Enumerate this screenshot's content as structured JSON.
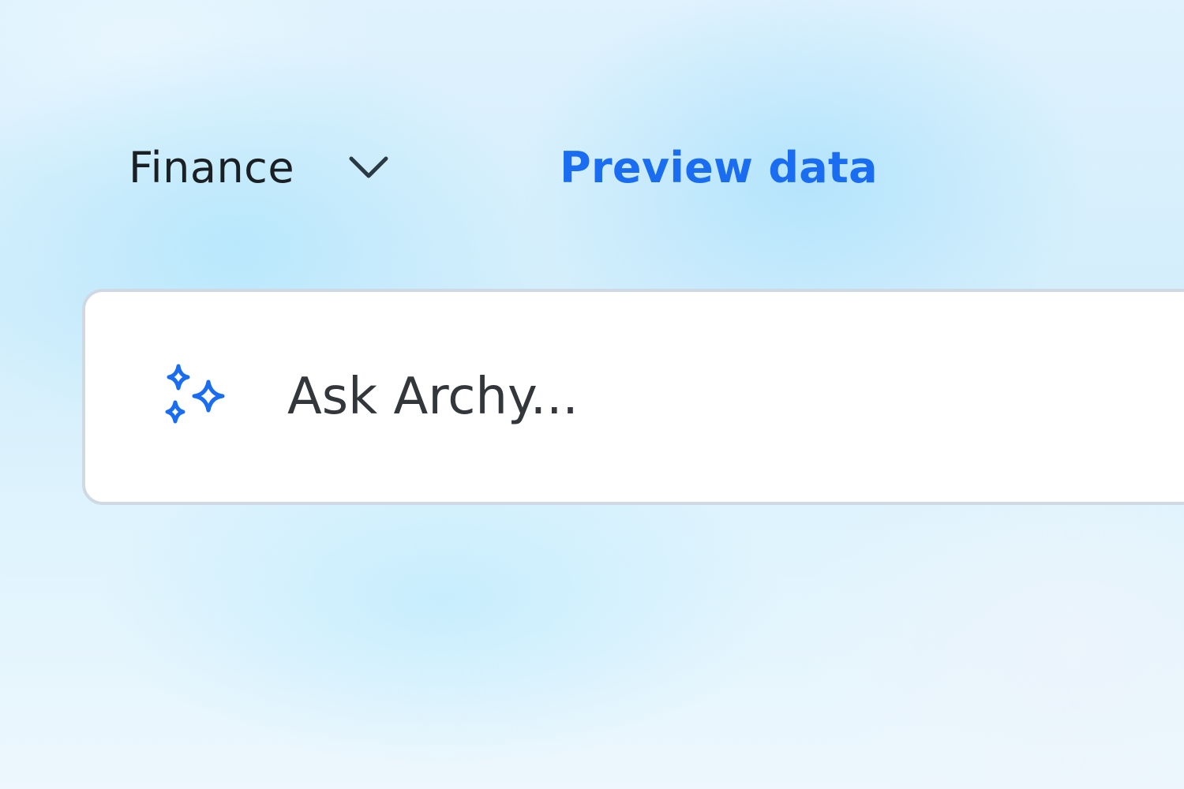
{
  "toolbar": {
    "dropdown": {
      "selected": "Finance",
      "icon": "chevron-down-icon"
    },
    "preview_link": "Preview data"
  },
  "ask": {
    "icon": "sparkle-icon",
    "placeholder": "Ask Archy..."
  },
  "colors": {
    "accent": "#1a6df0",
    "text_dark": "#1a1f24",
    "border": "#cfd9e3"
  }
}
